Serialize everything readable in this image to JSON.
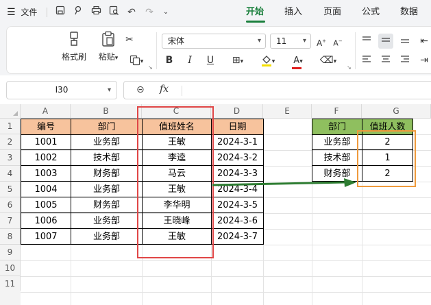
{
  "menubar": {
    "menu_label": "文件",
    "tabs": [
      {
        "label": "开始",
        "active": true
      },
      {
        "label": "插入",
        "active": false
      },
      {
        "label": "页面",
        "active": false
      },
      {
        "label": "公式",
        "active": false
      },
      {
        "label": "数据",
        "active": false
      }
    ]
  },
  "ribbon": {
    "format_painter": "格式刷",
    "paste": "粘贴",
    "font_name": "宋体",
    "font_size": "11"
  },
  "formula_bar": {
    "name_box": "I30",
    "fx": "fx",
    "formula": ""
  },
  "grid": {
    "columns": [
      "A",
      "B",
      "C",
      "D",
      "E",
      "F",
      "G"
    ],
    "rows": [
      "1",
      "2",
      "3",
      "4",
      "5",
      "6",
      "7",
      "8",
      "9",
      "10",
      "11"
    ],
    "table1": {
      "headers": [
        "编号",
        "部门",
        "值班姓名",
        "日期"
      ],
      "rows": [
        [
          "1001",
          "业务部",
          "王敏",
          "2024-3-1"
        ],
        [
          "1002",
          "技术部",
          "李逵",
          "2024-3-2"
        ],
        [
          "1003",
          "财务部",
          "马云",
          "2024-3-3"
        ],
        [
          "1004",
          "业务部",
          "王敏",
          "2024-3-4"
        ],
        [
          "1005",
          "财务部",
          "李华明",
          "2024-3-5"
        ],
        [
          "1006",
          "业务部",
          "王晓峰",
          "2024-3-6"
        ],
        [
          "1007",
          "业务部",
          "王敏",
          "2024-3-7"
        ]
      ]
    },
    "table2": {
      "headers": [
        "部门",
        "值班人数"
      ],
      "rows": [
        [
          "业务部",
          "2"
        ],
        [
          "技术部",
          "1"
        ],
        [
          "财务部",
          "2"
        ]
      ]
    }
  },
  "colors": {
    "accent": "#1a7f3c",
    "header1": "#f7c39d",
    "header2": "#8fbf5f",
    "highlight_red": "#e04646",
    "highlight_orange": "#ef9a3c",
    "arrow": "#2e7d32"
  }
}
